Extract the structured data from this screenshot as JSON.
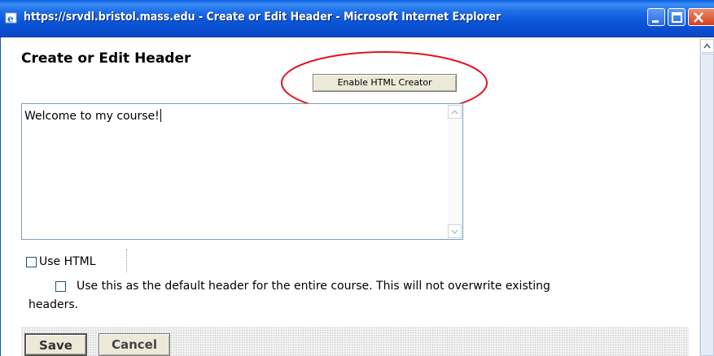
{
  "window": {
    "title": "https://srvdl.bristol.mass.edu - Create or Edit Header - Microsoft Internet Explorer",
    "icon": "ie-icon"
  },
  "page": {
    "heading": "Create or Edit Header",
    "enable_html_creator_label": "Enable HTML Creator",
    "textarea_value": "Welcome to my course!",
    "use_html_label": "Use HTML",
    "default_header_label_line1": "Use this as the default header for the entire course. This will not overwrite existing",
    "default_header_label_line2": "headers.",
    "save_label": "Save",
    "cancel_label": "Cancel"
  },
  "annotation": {
    "color": "#e0141c",
    "shape": "ellipse"
  },
  "colors": {
    "titlebar": "#0a55d8",
    "button_face": "#ece9d8"
  }
}
